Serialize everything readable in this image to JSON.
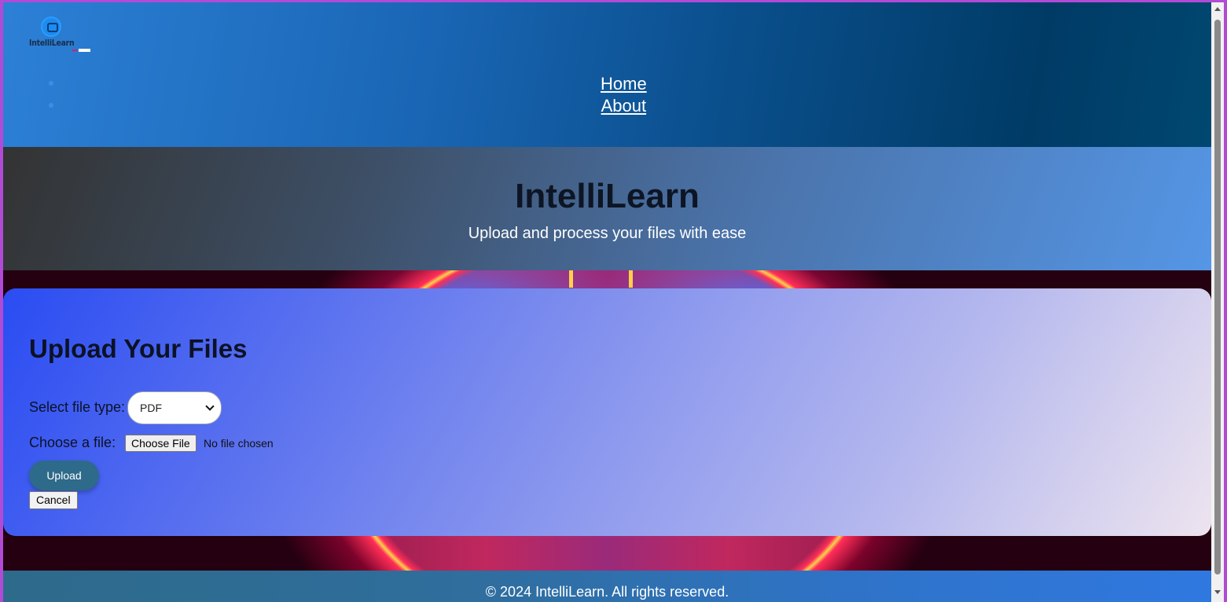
{
  "header": {
    "logo_text": "IntelliLearn",
    "nav": [
      {
        "label": "Home"
      },
      {
        "label": "About"
      }
    ]
  },
  "hero": {
    "title": "IntelliLearn",
    "subtitle": "Upload and process your files with ease"
  },
  "upload": {
    "heading": "Upload Your Files",
    "file_type_label": "Select file type:",
    "file_type_value": "PDF",
    "choose_label": "Choose a file:",
    "choose_button": "Choose File",
    "no_file_text": "No file chosen",
    "upload_button": "Upload",
    "cancel_button": "Cancel"
  },
  "footer": {
    "text": "© 2024 IntelliLearn. All rights reserved."
  },
  "colors": {
    "frame_border": "#b14bd6",
    "upload_button": "#2e6a8a"
  }
}
